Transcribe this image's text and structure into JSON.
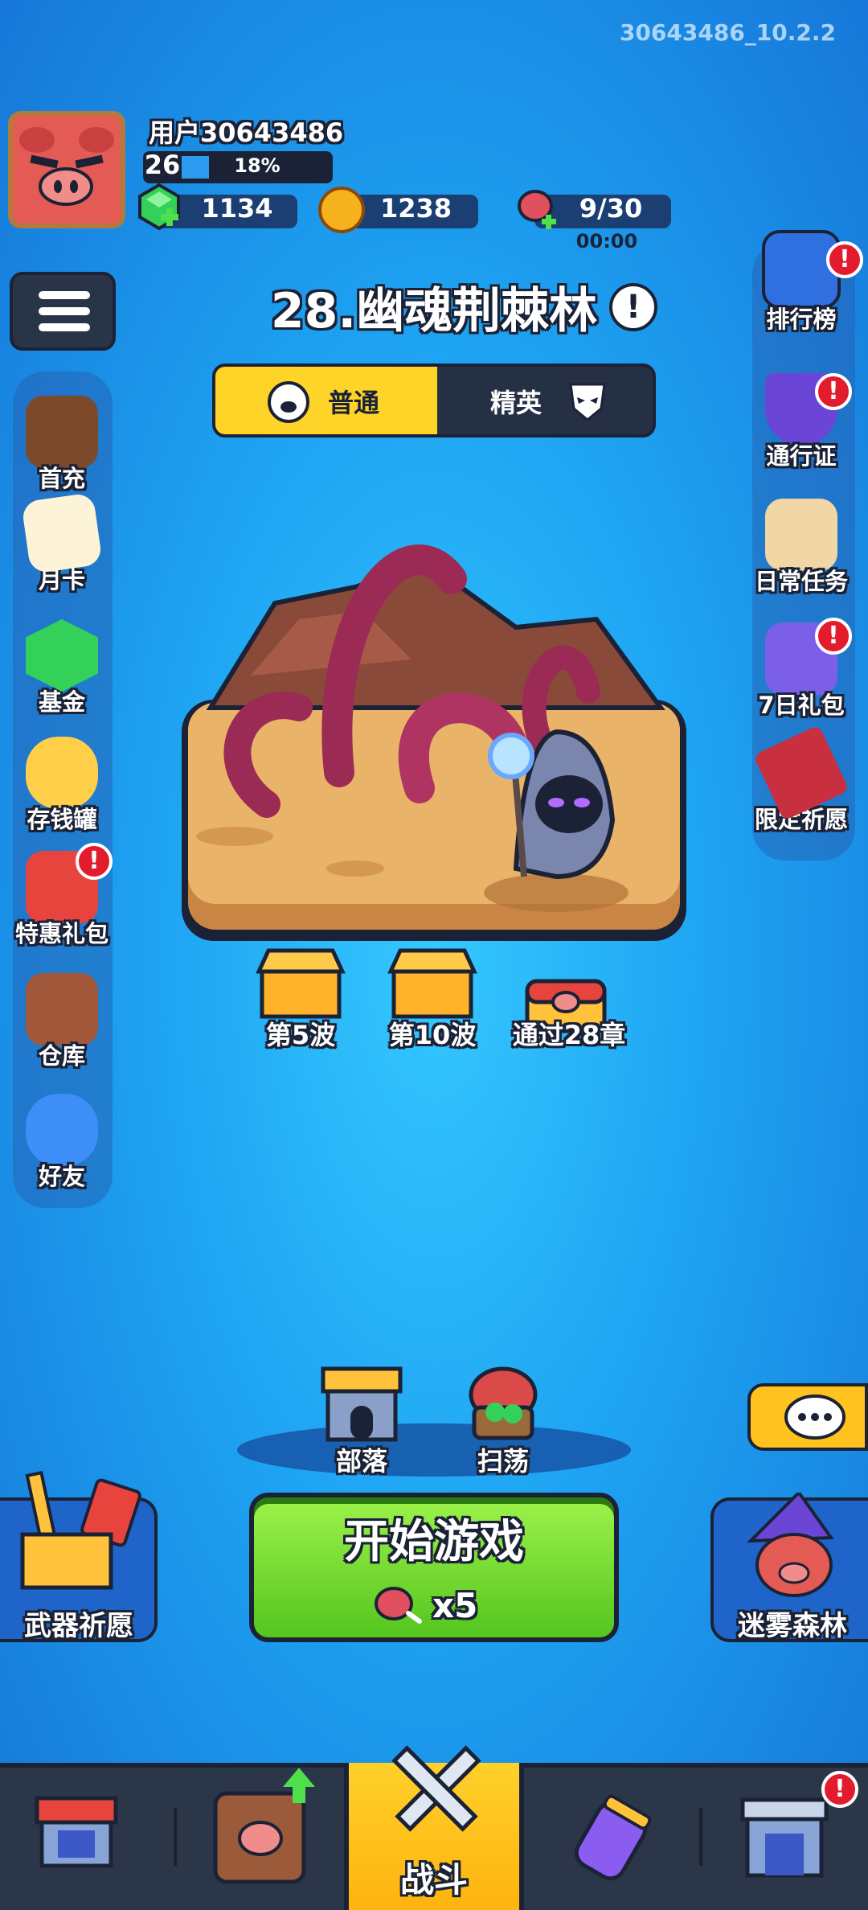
{
  "app": {
    "version": "30643486_10.2.2"
  },
  "profile": {
    "username": "用户30643486",
    "level": "26",
    "level_progress_label": "18%",
    "level_progress": 0.18
  },
  "resources": {
    "gems": "1134",
    "coins": "1238",
    "stamina": "9/30",
    "stamina_timer": "00:00"
  },
  "level": {
    "title": "28.幽魂荆棘林",
    "info_icon": "!"
  },
  "difficulty": {
    "tabs": [
      {
        "label": "普通",
        "selected": true
      },
      {
        "label": "精英",
        "selected": false
      }
    ]
  },
  "left_menu": [
    {
      "label": "首充",
      "badge": false
    },
    {
      "label": "月卡",
      "badge": false
    },
    {
      "label": "基金",
      "badge": false
    },
    {
      "label": "存钱罐",
      "badge": false
    },
    {
      "label": "特惠礼包",
      "badge": true
    },
    {
      "label": "仓库",
      "badge": false
    },
    {
      "label": "好友",
      "badge": false
    }
  ],
  "right_menu": [
    {
      "label": "排行榜",
      "badge": true
    },
    {
      "label": "通行证",
      "badge": true
    },
    {
      "label": "日常任务",
      "badge": false
    },
    {
      "label": "7日礼包",
      "badge": true
    },
    {
      "label": "限定祈愿",
      "badge": false
    }
  ],
  "rewards": [
    {
      "label": "第5波"
    },
    {
      "label": "第10波"
    },
    {
      "label": "通过28章"
    }
  ],
  "actions": {
    "tribe": "部落",
    "sweep": "扫荡",
    "weapon_wish": "武器祈愿",
    "mist_forest": "迷雾森林"
  },
  "start": {
    "label": "开始游戏",
    "cost": "x5"
  },
  "bottom_nav": [
    {
      "label": ""
    },
    {
      "label": ""
    },
    {
      "label": "战斗"
    },
    {
      "label": ""
    },
    {
      "label": ""
    }
  ],
  "badge_text": "!",
  "colors": {
    "accent_yellow": "#ffd428",
    "start_green": "#6fd82a",
    "badge_red": "#e21b2d",
    "dark": "#1b2236"
  }
}
